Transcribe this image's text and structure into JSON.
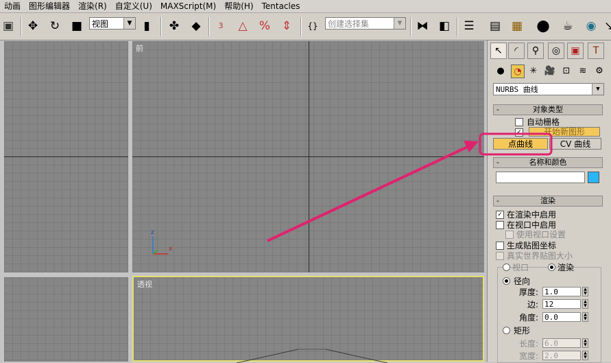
{
  "menu": [
    "动画",
    "图形编辑器",
    "渲染(R)",
    "自定义(U)",
    "MAXScript(M)",
    "帮助(H)",
    "Tentacles"
  ],
  "toolbar": {
    "view_dropdown": "视图",
    "selection_set_placeholder": "创建选择集",
    "angle_snap_label": "3",
    "percent_snap_label": "%"
  },
  "viewports": {
    "front": "前",
    "perspective": "透视",
    "axis_z": "z",
    "axis_x": "x"
  },
  "panel": {
    "category_dropdown": "NURBS 曲线",
    "rollout_object_type": {
      "title": "对象类型",
      "auto_grid": "自动栅格",
      "auto_grid_checked": false,
      "start_new_shape": "开始新图形",
      "start_new_shape_checked": true,
      "point_curve": "点曲线",
      "cv_curve": "CV 曲线"
    },
    "rollout_name_color": {
      "title": "名称和颜色",
      "name_value": "",
      "color": "#29b6f6"
    },
    "rollout_rendering": {
      "title": "渲染",
      "enable_in_renderer": "在渲染中启用",
      "enable_in_renderer_checked": true,
      "enable_in_viewport": "在视口中启用",
      "use_viewport_settings": "使用视口设置",
      "generate_mapping_coords": "生成贴图坐标",
      "real_world_map_size": "真实世界贴图大小",
      "viewport_option": "视口",
      "renderer_option": "渲染",
      "radial": "径向",
      "thickness_label": "厚度:",
      "thickness_value": "1.0",
      "sides_label": "边:",
      "sides_value": "12",
      "angle_label": "角度:",
      "angle_value": "0.0",
      "rectangular": "矩形",
      "length_label": "长度:",
      "length_value": "6.0",
      "width_label": "宽度:",
      "width_value": "2.0"
    }
  },
  "annotation": {
    "highlight_color": "#e0226e"
  }
}
